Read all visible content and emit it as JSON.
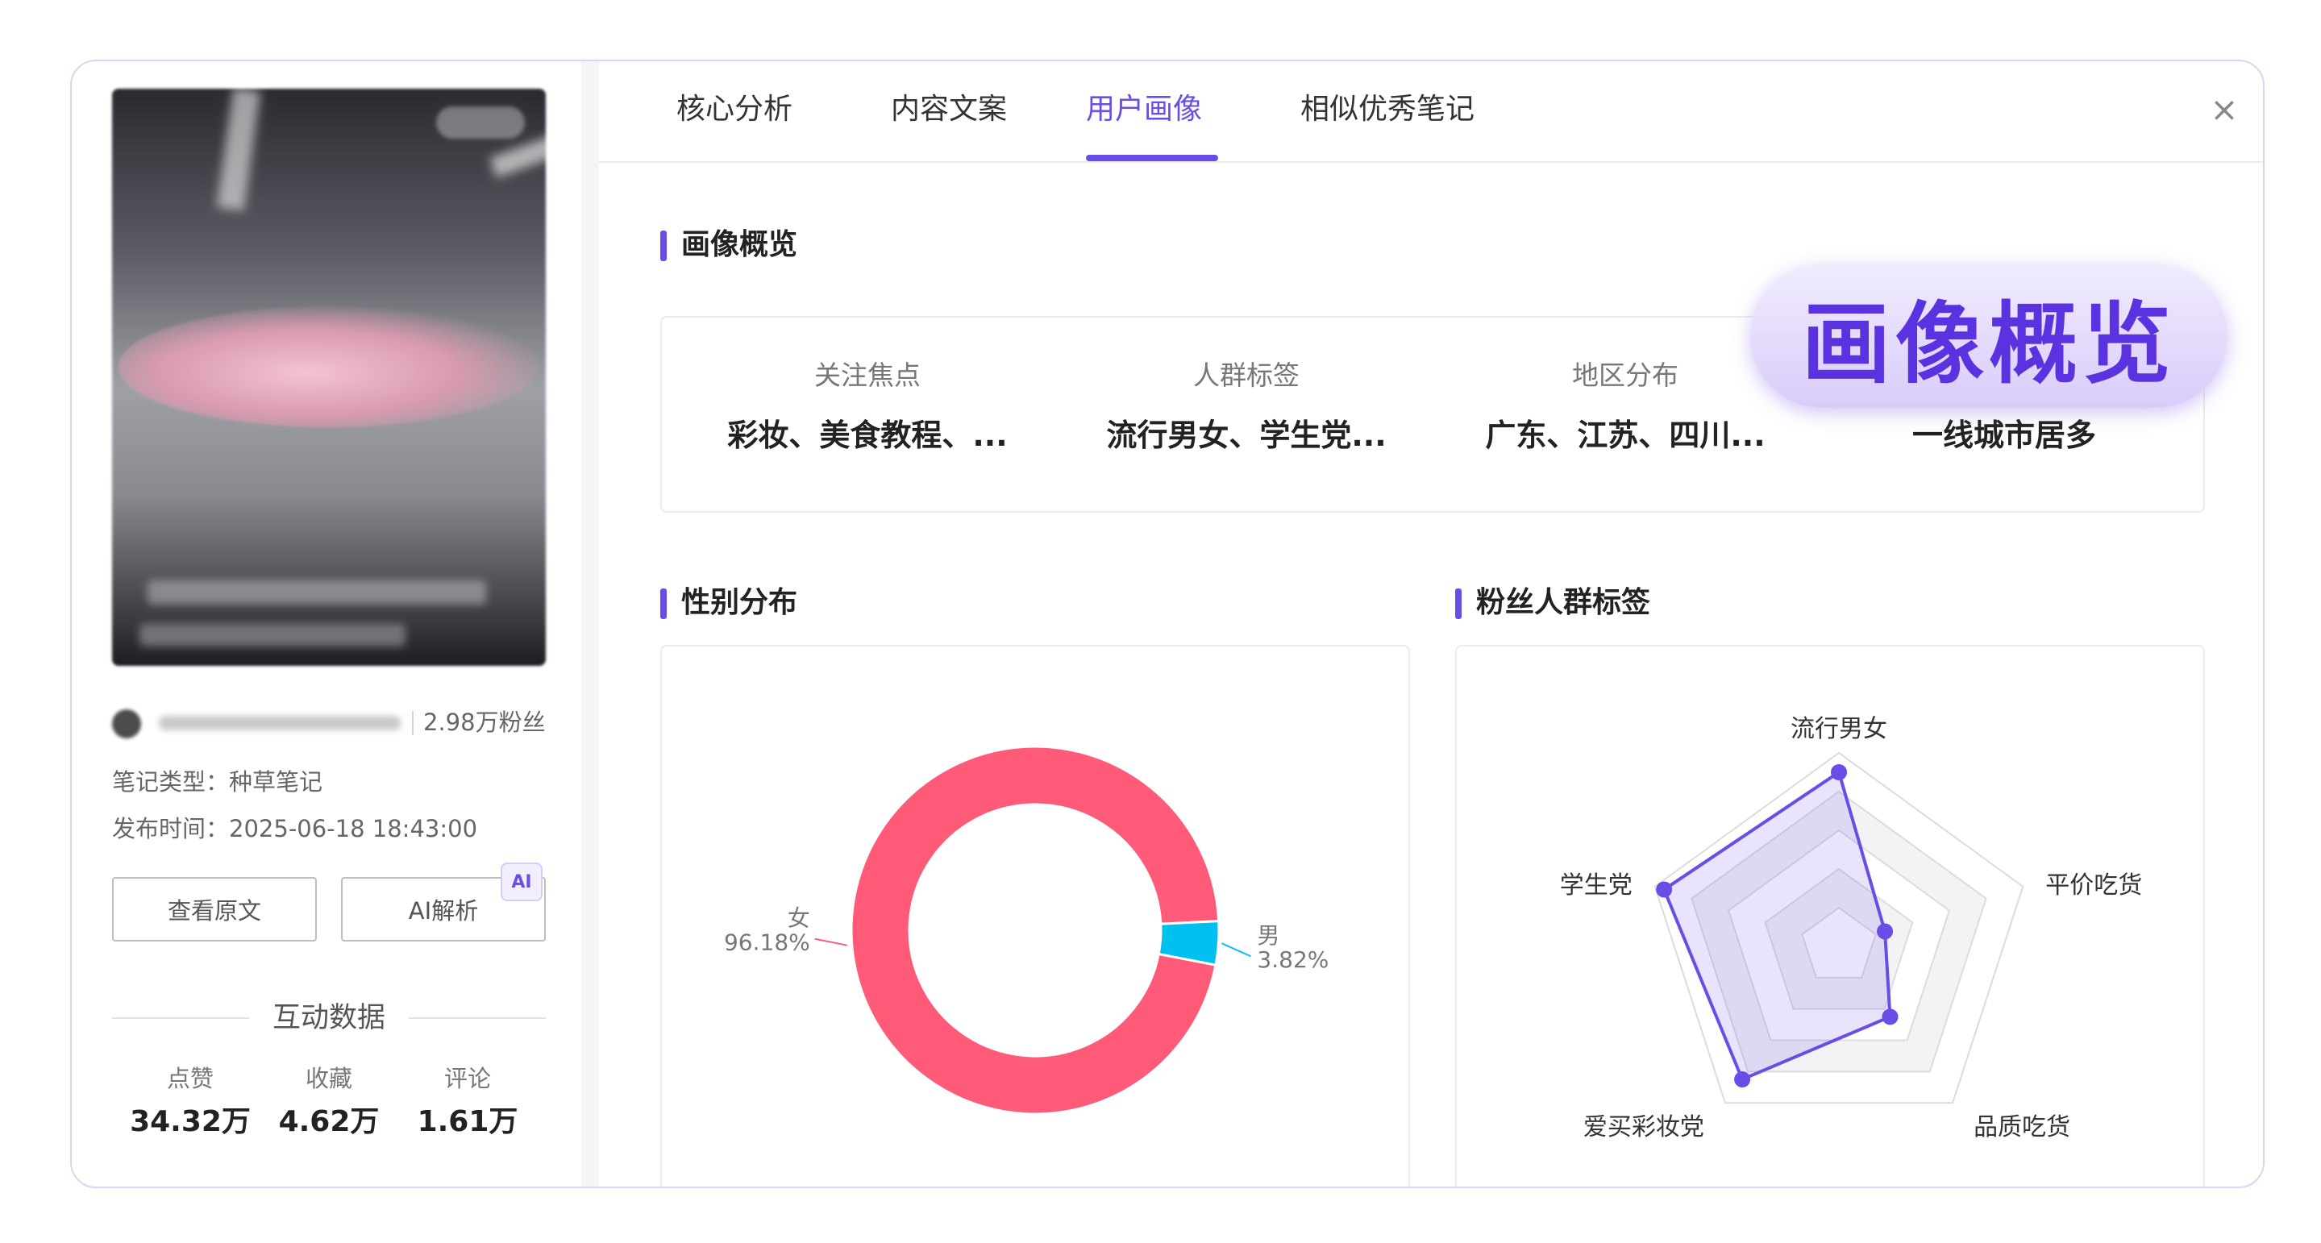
{
  "sidebar": {
    "fans": "2.98万粉丝",
    "note_type_label": "笔记类型：",
    "note_type": "种草笔记",
    "publish_label": "发布时间：",
    "publish_time": "2025-06-18 18:43:00",
    "view_original": "查看原文",
    "ai_analyze": "AI解析",
    "ai_badge": "AI",
    "interaction_title": "互动数据",
    "stats": [
      {
        "label": "点赞",
        "value": "34.32万"
      },
      {
        "label": "收藏",
        "value": "4.62万"
      },
      {
        "label": "评论",
        "value": "1.61万"
      }
    ]
  },
  "tabs": [
    {
      "label": "核心分析"
    },
    {
      "label": "内容文案"
    },
    {
      "label": "用户画像"
    },
    {
      "label": "相似优秀笔记"
    }
  ],
  "close_icon": "×",
  "overview": {
    "title": "画像概览",
    "callout": "画像概览",
    "items": [
      {
        "label": "关注焦点",
        "value": "彩妆、美食教程、..."
      },
      {
        "label": "人群标签",
        "value": "流行男女、学生党..."
      },
      {
        "label": "地区分布",
        "value": "广东、江苏、四川..."
      },
      {
        "label": "",
        "value": "一线城市居多"
      }
    ]
  },
  "gender": {
    "title": "性别分布"
  },
  "fan_tags": {
    "title": "粉丝人群标签"
  },
  "colors": {
    "accent": "#6a4ce6",
    "female": "#ff5a78",
    "male": "#00c0f0"
  },
  "chart_data": [
    {
      "type": "pie",
      "categories": [
        "女",
        "男"
      ],
      "values": [
        96.18,
        3.82
      ],
      "labels": [
        "96.18%",
        "3.82%"
      ],
      "donut": true
    },
    {
      "type": "radar",
      "categories": [
        "流行男女",
        "平价吃货",
        "品质吃货",
        "爱买彩妆党",
        "学生党"
      ],
      "values": [
        0.9,
        0.25,
        0.45,
        0.85,
        0.95
      ],
      "range": [
        0,
        1
      ]
    }
  ]
}
